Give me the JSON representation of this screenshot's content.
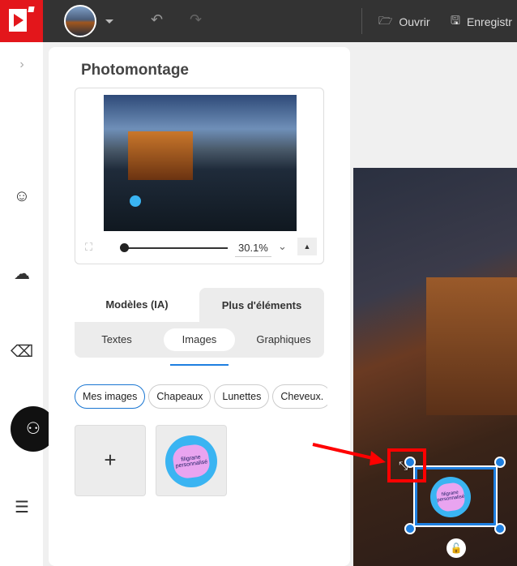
{
  "toolbar": {
    "open_label": "Ouvrir",
    "save_label": "Enregistr"
  },
  "panel": {
    "title": "Photomontage",
    "zoom_value": "30.1%",
    "tabs": [
      {
        "label": "Modèles (IA)"
      },
      {
        "label": "Plus d'éléments",
        "active": true
      }
    ],
    "subtabs": [
      {
        "label": "Textes"
      },
      {
        "label": "Images",
        "active": true
      },
      {
        "label": "Graphiques"
      }
    ],
    "chips": [
      {
        "label": "Mes images",
        "selected": true
      },
      {
        "label": "Chapeaux"
      },
      {
        "label": "Lunettes"
      },
      {
        "label": "Cheveux."
      }
    ],
    "add_label": "+",
    "watermark_text": "filigrane personnalisé"
  },
  "colors": {
    "brand": "#e3161b",
    "accent": "#1e7fe0",
    "highlight": "#ff0000"
  }
}
